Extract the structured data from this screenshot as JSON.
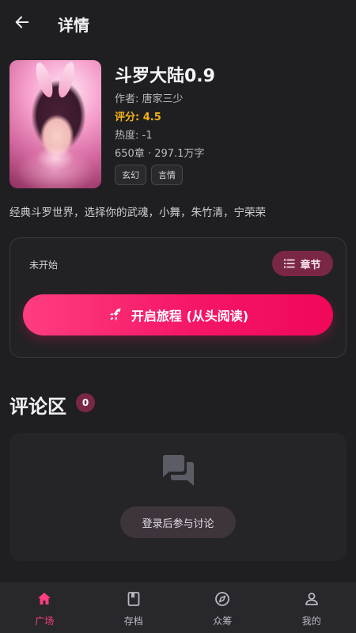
{
  "header": {
    "title": "详情"
  },
  "book": {
    "title": "斗罗大陆0.9",
    "author": "作者: 唐家三少",
    "rating": "评分: 4.5",
    "heat": "热度: -1",
    "stats": "650章 · 297.1万字",
    "tags": [
      "玄幻",
      "言情"
    ],
    "description": "经典斗罗世界，选择你的武魂，小舞，朱竹清，宁荣荣"
  },
  "reading": {
    "status": "未开始",
    "chapters_label": "章节",
    "start_label": "开启旅程 (从头阅读)"
  },
  "comments": {
    "title": "评论区",
    "count": "0",
    "login_label": "登录后参与讨论"
  },
  "nav": {
    "items": [
      {
        "label": "广场",
        "icon": "home-icon",
        "active": true
      },
      {
        "label": "存档",
        "icon": "book-icon",
        "active": false
      },
      {
        "label": "众筹",
        "icon": "compass-icon",
        "active": false
      },
      {
        "label": "我的",
        "icon": "user-icon",
        "active": false
      }
    ]
  },
  "colors": {
    "background": "#1f1f22",
    "accent": "#ff3d7f",
    "rating": "#f2b31b",
    "badge": "#7a2747"
  }
}
